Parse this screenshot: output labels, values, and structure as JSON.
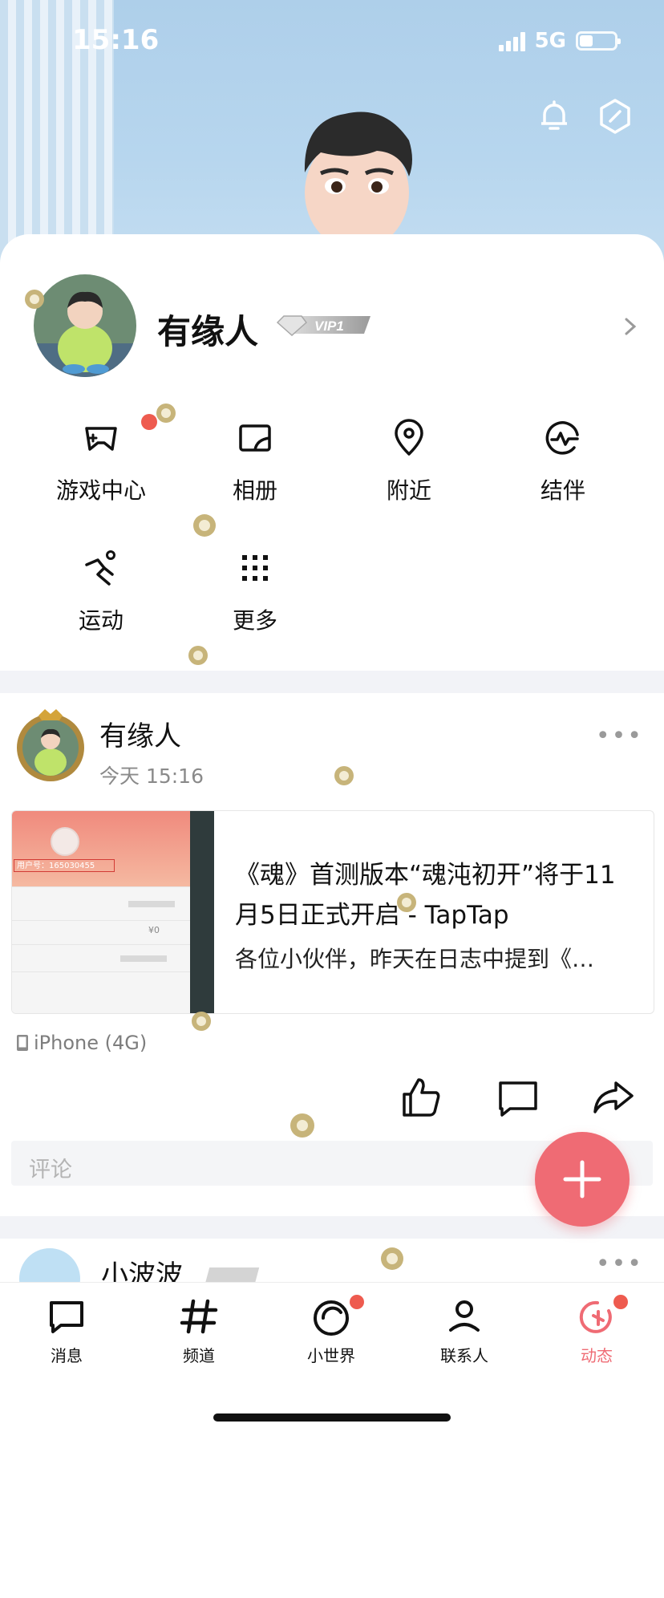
{
  "status_bar": {
    "time": "15:16",
    "network": "5G"
  },
  "hero": {
    "icons": [
      "bell-icon",
      "hexagon-settings-icon"
    ]
  },
  "profile": {
    "name": "有缘人",
    "vip": "VIP1"
  },
  "shortcuts": [
    {
      "label": "游戏中心",
      "icon": "gamepad-icon",
      "badge": true
    },
    {
      "label": "相册",
      "icon": "album-icon"
    },
    {
      "label": "附近",
      "icon": "location-pin-icon"
    },
    {
      "label": "结伴",
      "icon": "pulse-circle-icon"
    },
    {
      "label": "运动",
      "icon": "running-icon"
    },
    {
      "label": "更多",
      "icon": "grid-dots-icon"
    }
  ],
  "post": {
    "author": "有缘人",
    "time": "今天 15:16",
    "more": "•••",
    "link": {
      "title": "《魂》首测版本“魂沌初开”将于11月5日正式开启 - TapTap",
      "description": "各位小伙伴，昨天在日志中提到《…",
      "thumb_user_id": "用户号：165030455",
      "thumb_amount": "¥0"
    },
    "device": "iPhone (4G)",
    "comment_placeholder": "评论"
  },
  "next_post": {
    "author": "小波波"
  },
  "tabs": [
    {
      "label": "消息",
      "icon": "message-icon"
    },
    {
      "label": "频道",
      "icon": "hashtag-icon"
    },
    {
      "label": "小世界",
      "icon": "world-icon",
      "badge": true
    },
    {
      "label": "联系人",
      "icon": "contact-icon"
    },
    {
      "label": "动态",
      "icon": "dynamic-star-icon",
      "badge": true,
      "active": true
    }
  ],
  "colors": {
    "accent": "#ef6b74",
    "active_tab": "#ef6b74",
    "badge": "#ee5b4f",
    "hero_bg": "#b7d6ee"
  }
}
